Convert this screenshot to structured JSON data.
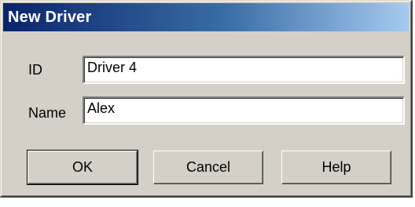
{
  "dialog": {
    "title": "New Driver"
  },
  "form": {
    "id_label": "ID",
    "id_value": "Driver 4",
    "name_label": "Name",
    "name_value": "Alex"
  },
  "buttons": {
    "ok": "OK",
    "cancel": "Cancel",
    "help": "Help"
  }
}
